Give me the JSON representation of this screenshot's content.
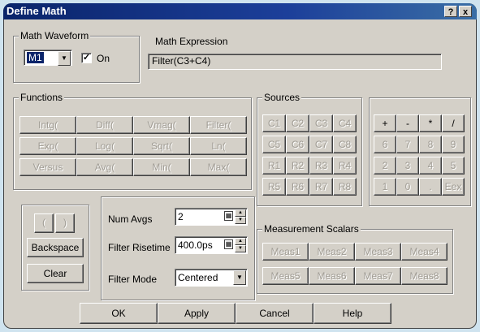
{
  "window": {
    "title": "Define Math",
    "help_button": "?",
    "close_button": "x"
  },
  "math_waveform": {
    "group_label": "Math Waveform",
    "select_value": "M1",
    "on_label": "On",
    "on_checked": true
  },
  "math_expression": {
    "label": "Math Expression",
    "value": "Filter(C3+C4)"
  },
  "functions": {
    "group_label": "Functions",
    "buttons": [
      "Intg(",
      "Diff(",
      "Vmag(",
      "Filter(",
      "Exp(",
      "Log(",
      "Sqrt(",
      "Ln(",
      "Versus",
      "Avg(",
      "Min(",
      "Max("
    ]
  },
  "sources": {
    "group_label": "Sources",
    "buttons": [
      "C1",
      "C2",
      "C3",
      "C4",
      "C5",
      "C6",
      "C7",
      "C8",
      "R1",
      "R2",
      "R3",
      "R4",
      "R5",
      "R6",
      "R7",
      "R8"
    ]
  },
  "keypad": {
    "buttons": [
      "+",
      "-",
      "*",
      "/",
      "6",
      "7",
      "8",
      "9",
      "2",
      "3",
      "4",
      "5",
      "1",
      "0",
      ".",
      "Eex"
    ]
  },
  "edit": {
    "open_paren": "(",
    "close_paren": ")",
    "backspace": "Backspace",
    "clear": "Clear"
  },
  "params": {
    "num_avgs_label": "Num Avgs",
    "num_avgs_value": "2",
    "filter_risetime_label": "Filter Risetime",
    "filter_risetime_value": "400.0ps",
    "filter_mode_label": "Filter Mode",
    "filter_mode_value": "Centered"
  },
  "measurement_scalars": {
    "group_label": "Measurement Scalars",
    "buttons": [
      "Meas1",
      "Meas2",
      "Meas3",
      "Meas4",
      "Meas5",
      "Meas6",
      "Meas7",
      "Meas8"
    ]
  },
  "footer": {
    "ok": "OK",
    "apply": "Apply",
    "cancel": "Cancel",
    "help": "Help"
  },
  "icons": {
    "dropdown": "chevron-down-icon",
    "spin": "spinner-icon",
    "calculator": "calculator-icon",
    "check": "check-icon"
  }
}
